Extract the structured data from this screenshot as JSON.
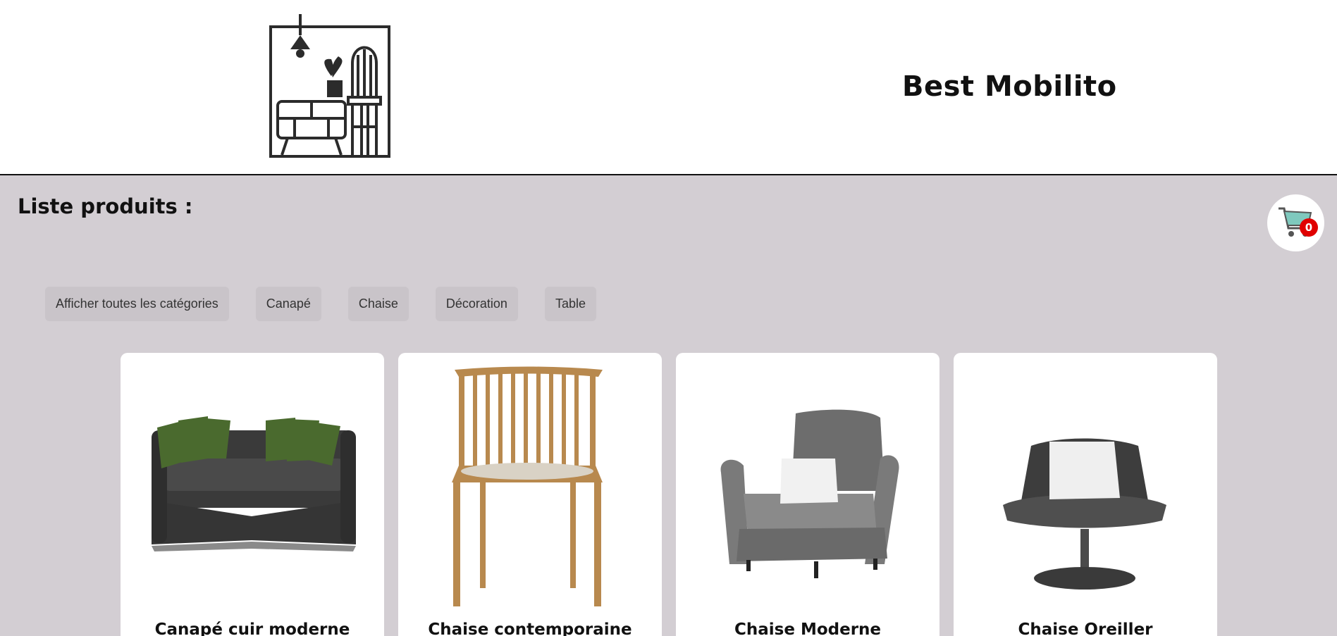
{
  "brand": {
    "name": "Best Mobilito",
    "logo_icon": "furniture-frame-logo"
  },
  "section": {
    "title": "Liste produits :"
  },
  "cart": {
    "icon": "shopping-cart-icon",
    "count": "0"
  },
  "filters": [
    {
      "label": "Afficher toutes les catégories"
    },
    {
      "label": "Canapé"
    },
    {
      "label": "Chaise"
    },
    {
      "label": "Décoration"
    },
    {
      "label": "Table"
    }
  ],
  "products": [
    {
      "name": "Canapé cuir moderne",
      "image": "sofa-image"
    },
    {
      "name": "Chaise contemporaine",
      "image": "wooden-chair-image"
    },
    {
      "name": "Chaise Moderne",
      "image": "armchair-image"
    },
    {
      "name": "Chaise Oreiller",
      "image": "swivel-chair-image"
    }
  ],
  "colors": {
    "background": "#d3ced3",
    "badge": "#e00000",
    "cart": "#7fc9be"
  }
}
